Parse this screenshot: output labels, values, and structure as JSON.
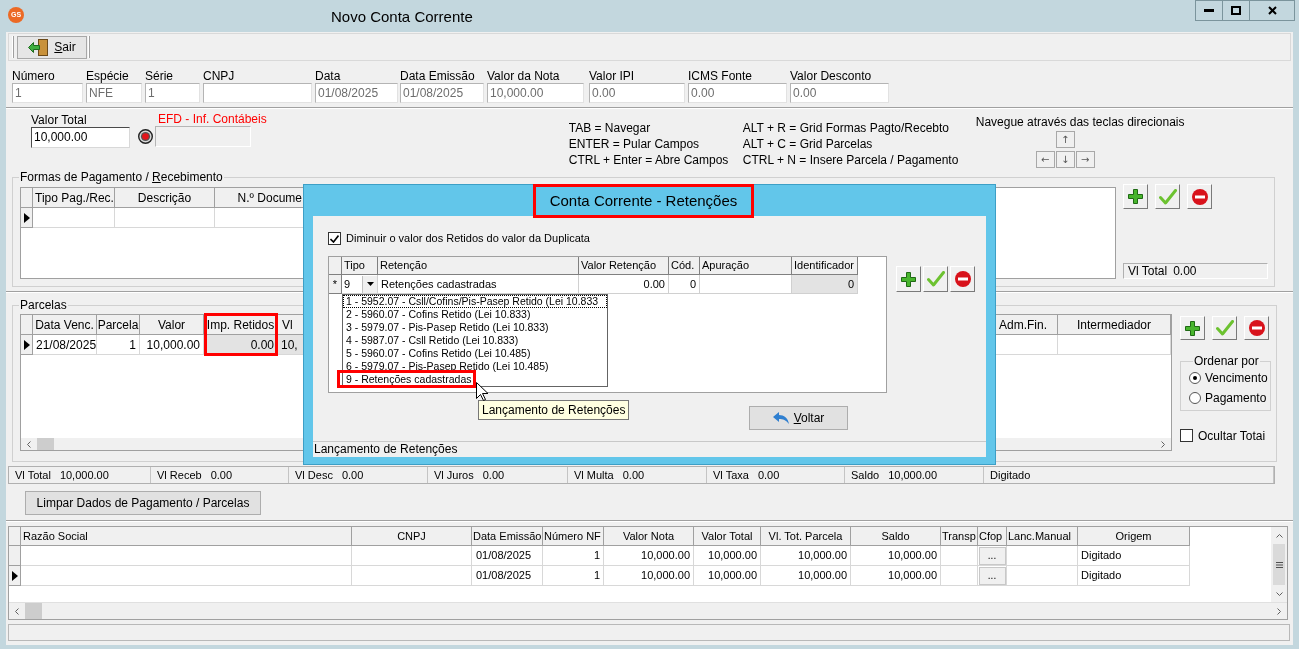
{
  "window": {
    "logo": "GS",
    "title": "Novo Conta Corrente"
  },
  "toolbar": {
    "buttons": [
      {
        "label": [
          {
            "text": "S",
            "underline": true
          },
          {
            "text": "air",
            "underline": false
          }
        ]
      }
    ]
  },
  "document_fields": [
    {
      "label": "Número",
      "value": "1",
      "disabled": true
    },
    {
      "label": "Espécie",
      "value": "NFE",
      "disabled": true
    },
    {
      "label": "Série",
      "value": "1",
      "disabled": true
    },
    {
      "label": "CNPJ",
      "disabled": true
    },
    {
      "label": "Data",
      "value": "01/08/2025",
      "disabled": true
    },
    {
      "label": "Data Emissão",
      "value": "01/08/2025",
      "disabled": true
    },
    {
      "label": "Valor da Nota",
      "value": "10,000.00",
      "disabled": true
    },
    {
      "label": "Valor IPI",
      "value": "0.00",
      "disabled": true
    },
    {
      "label": "ICMS Fonte",
      "value": "0.00",
      "disabled": true
    },
    {
      "label": "Valor Desconto",
      "value": "0.00",
      "disabled": true
    }
  ],
  "valor_total": {
    "label": "Valor Total",
    "value": "10,000.00"
  },
  "efd": {
    "label": "EFD - Inf. Contábeis"
  },
  "shortcuts": [
    [
      "TAB = Navegar",
      "ENTER = Pular Campos",
      "CTRL + Enter = Abre Campos"
    ],
    [
      "ALT + R = Grid Formas Pagto/Recebto",
      "ALT + C = Grid Parcelas",
      "CTRL + N = Insere Parcela / Pagamento"
    ]
  ],
  "arrow_keys": {
    "caption": "Navegue através das teclas direcionais",
    "keys": [
      "↑",
      "←",
      "↓",
      "→"
    ]
  },
  "payments": {
    "title": [
      {
        "text": "Formas de Pagamento / ",
        "underline": false
      },
      {
        "text": "R",
        "underline": true
      },
      {
        "text": "ecebimento",
        "underline": false
      }
    ],
    "columns": [
      "Tipo Pag./Rec.",
      "Descrição",
      "N.º Docume"
    ],
    "rows": [
      {
        "current": true
      }
    ],
    "total": {
      "label": "Vl Total",
      "value": "0.00"
    }
  },
  "installments": {
    "title": "Parcelas",
    "columns": [
      {
        "label": "Data Venc.",
        "highlighted": false,
        "readonly": false
      },
      {
        "label": "Parcela",
        "highlighted": false,
        "readonly": false
      },
      {
        "label": "Valor",
        "highlighted": false,
        "readonly": false
      },
      {
        "label": "Imp. Retidos",
        "highlighted": true,
        "readonly": true
      },
      {
        "label": "Vl",
        "highlighted": false,
        "readonly": true
      }
    ],
    "trailing_columns": [
      "Adm.Fin.",
      "Intermediador"
    ],
    "rows": [
      {
        "current": true,
        "cells": [
          "21/08/2025",
          "1",
          "10,000.00",
          "0.00",
          "10,"
        ]
      }
    ]
  },
  "sort": {
    "title": "Ordenar por",
    "options": [
      {
        "label": "Vencimento",
        "selected": true
      },
      {
        "label": "Pagamento",
        "selected": false
      }
    ]
  },
  "hide_totals": {
    "label": "Ocultar Totai",
    "checked": false
  },
  "totals": [
    {
      "label": "Vl Total",
      "value": "10,000.00"
    },
    {
      "label": "Vl Receb",
      "value": "0.00"
    },
    {
      "label": "Vl Desc",
      "value": "0.00"
    },
    {
      "label": "Vl Juros",
      "value": "0.00"
    },
    {
      "label": "Vl Multa",
      "value": "0.00"
    },
    {
      "label": "Vl Taxa",
      "value": "0.00"
    },
    {
      "label": "Saldo",
      "value": "10,000.00"
    },
    {
      "label": "Digitado"
    }
  ],
  "clear_button": {
    "label": "Limpar Dados de Pagamento / Parcelas"
  },
  "documents": {
    "columns": [
      "Razão Social",
      "CNPJ",
      "Data Emissão",
      "Número NF",
      "Valor Nota",
      "Valor Total",
      "Vl. Tot. Parcela",
      "Saldo",
      "Transp",
      "Cfop",
      "Lanc.Manual",
      "Origem"
    ],
    "rows": [
      {
        "current": false,
        "data_emissao": "01/08/2025",
        "numero_nf": "1",
        "valor_nota": "10,000.00",
        "valor_total": "10,000.00",
        "vl_tot_parcela": "10,000.00",
        "saldo": "10,000.00",
        "cfop": "...",
        "origem": "Digitado"
      },
      {
        "current": true,
        "data_emissao": "01/08/2025",
        "numero_nf": "1",
        "valor_nota": "10,000.00",
        "valor_total": "10,000.00",
        "vl_tot_parcela": "10,000.00",
        "saldo": "10,000.00",
        "cfop": "...",
        "origem": "Digitado"
      }
    ]
  },
  "dialog": {
    "title": "Conta Corrente - Retenções",
    "title_highlighted": true,
    "deduct_option": {
      "label": "Diminuir o valor dos Retidos do valor da Duplicata",
      "checked": true
    },
    "columns": [
      "Tipo",
      "Retenção",
      "Valor Retenção",
      "Cód.",
      "Apuração",
      "Identificador"
    ],
    "new_row": {
      "marker": "*",
      "tipo": "9",
      "retencao": "Retenções cadastradas",
      "valor_retencao": "0.00",
      "cod": "0",
      "identificador": "0"
    },
    "tipo_options": [
      {
        "label": "1 - 5952.07 - Csll/Cofins/Pis-Pasep Retido (Lei 10.833",
        "focused": true,
        "highlighted": false
      },
      {
        "label": "2 - 5960.07 - Cofins Retido (Lei 10.833)",
        "focused": false,
        "highlighted": false
      },
      {
        "label": "3 - 5979.07 - Pis-Pasep Retido (Lei 10.833)",
        "focused": false,
        "highlighted": false
      },
      {
        "label": "4 - 5987.07 - Csll Retido (Lei 10.833)",
        "focused": false,
        "highlighted": false
      },
      {
        "label": "5 - 5960.07 - Cofins Retido (Lei 10.485)",
        "focused": false,
        "highlighted": false
      },
      {
        "label": "6 - 5979.07 - Pis-Pasep Retido (Lei 10.485)",
        "focused": false,
        "highlighted": false
      },
      {
        "label": "9 - Retenções cadastradas",
        "focused": false,
        "highlighted": true
      }
    ],
    "tooltip": "Lançamento de Retenções",
    "back_button": {
      "label": [
        {
          "text": "V",
          "underline": true
        },
        {
          "text": "oltar",
          "underline": false
        }
      ]
    },
    "status": "Lançamento de Retenções"
  }
}
